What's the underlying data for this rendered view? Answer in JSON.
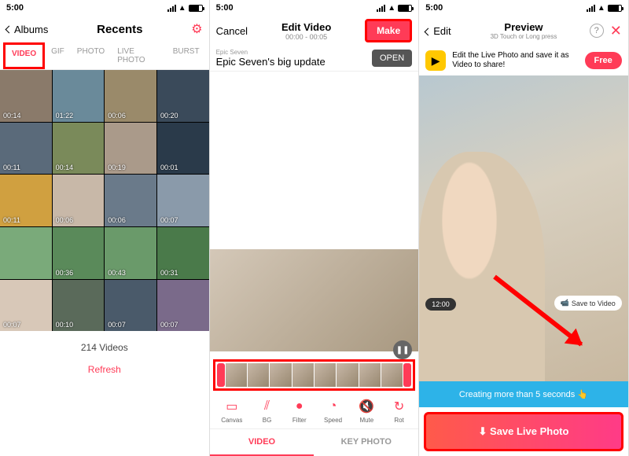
{
  "status": {
    "time": "5:00",
    "loc_arrow": "↑"
  },
  "screen1": {
    "back_label": "Albums",
    "title": "Recents",
    "tabs": [
      "VIDEO",
      "GIF",
      "PHOTO",
      "LIVE PHOTO",
      "BURST"
    ],
    "durations": [
      "00:14",
      "01:22",
      "00:06",
      "00:20",
      "00:11",
      "00:14",
      "00:19",
      "00:01",
      "00:11",
      "00:06",
      "00:06",
      "00:07",
      "",
      "00:36",
      "00:43",
      "00:31",
      "00:07",
      "00:10",
      "00:07",
      "00:07"
    ],
    "count_text": "214 Videos",
    "refresh_label": "Refresh"
  },
  "screen2": {
    "cancel": "Cancel",
    "title": "Edit Video",
    "subtitle": "00:00 - 00:05",
    "make": "Make",
    "ad_label": "Epic Seven",
    "ad_title": "Epic Seven's big update",
    "open": "OPEN",
    "tools": [
      {
        "icon": "▭",
        "label": "Canvas"
      },
      {
        "icon": "⫽",
        "label": "BG"
      },
      {
        "icon": "●",
        "label": "Filter"
      },
      {
        "icon": "◔",
        "label": "Speed"
      },
      {
        "icon": "🔇",
        "label": "Mute"
      },
      {
        "icon": "↻",
        "label": "Rot"
      }
    ],
    "bottom_tabs": [
      "VIDEO",
      "KEY PHOTO"
    ]
  },
  "screen3": {
    "edit": "Edit",
    "title": "Preview",
    "subtitle": "3D Touch or Long press",
    "banner_text": "Edit the Live Photo and save it as Video to share!",
    "free": "Free",
    "time_chip": "12:00",
    "save_video": "Save to Video",
    "info_text": "Creating more than 5 seconds 👆",
    "save_button": "⬇ Save Live Photo"
  }
}
